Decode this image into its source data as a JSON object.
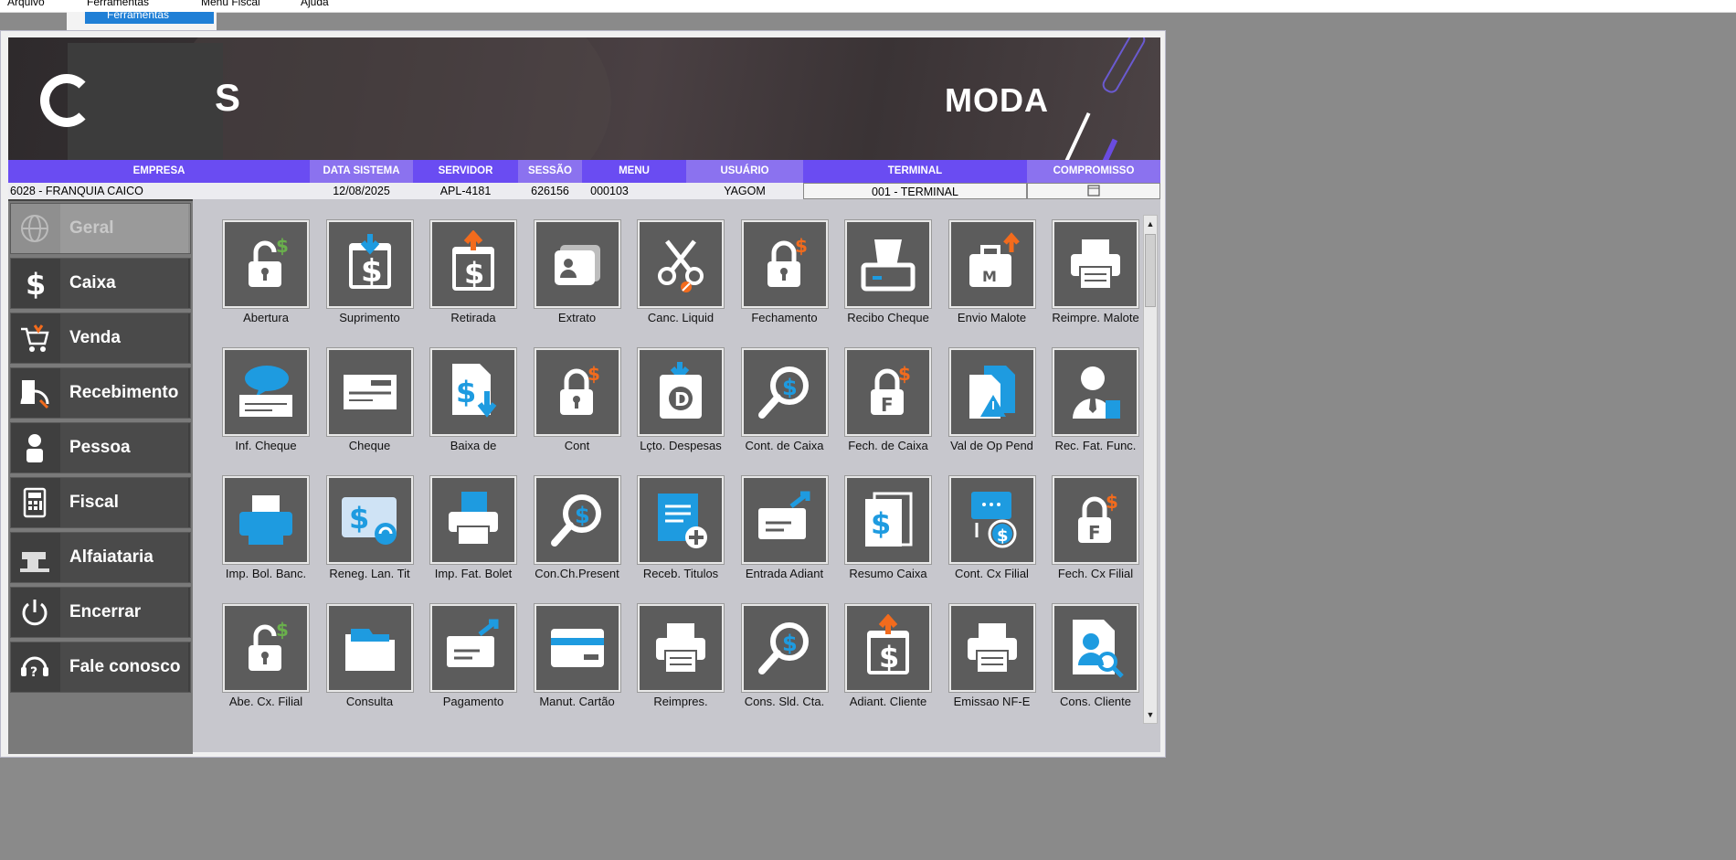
{
  "menubar": {
    "items": [
      "Arquivo",
      "Ferramentas",
      "Menu Fiscal",
      "Ajuda"
    ],
    "dropdown_highlight": "Ferramentas"
  },
  "banner": {
    "brand_suffix": "S",
    "tagline": "MODA"
  },
  "header": {
    "columns": [
      "EMPRESA",
      "DATA SISTEMA",
      "SERVIDOR",
      "SESSÃO",
      "MENU",
      "USUÁRIO",
      "TERMINAL",
      "COMPROMISSO"
    ],
    "values": [
      "6028 - FRANQUIA CAICO",
      "12/08/2025",
      "APL-4181",
      "626156",
      "000103",
      "YAGOM",
      "001 - TERMINAL",
      ""
    ]
  },
  "sidebar": {
    "items": [
      {
        "label": "Geral",
        "icon": "globe-icon",
        "disabled": true
      },
      {
        "label": "Caixa",
        "icon": "dollar-icon"
      },
      {
        "label": "Venda",
        "icon": "cart-icon"
      },
      {
        "label": "Recebimento",
        "icon": "receipt-icon"
      },
      {
        "label": "Pessoa",
        "icon": "person-icon"
      },
      {
        "label": "Fiscal",
        "icon": "calculator-icon"
      },
      {
        "label": "Alfaiataria",
        "icon": "sewing-machine-icon"
      },
      {
        "label": "Encerrar",
        "icon": "power-icon"
      },
      {
        "label": "Fale conosco",
        "icon": "headset-icon"
      }
    ]
  },
  "tiles": [
    {
      "label": "Abertura",
      "icon": "lock-open-dollar-icon"
    },
    {
      "label": "Suprimento",
      "icon": "cash-in-icon"
    },
    {
      "label": "Retirada",
      "icon": "cash-out-icon"
    },
    {
      "label": "Extrato",
      "icon": "id-card-icon"
    },
    {
      "label": "Canc. Liquid",
      "icon": "scissors-icon"
    },
    {
      "label": "Fechamento",
      "icon": "lock-dollar-icon"
    },
    {
      "label": "Recibo Cheque",
      "icon": "receipt-printer-icon"
    },
    {
      "label": "Envio Malote",
      "icon": "briefcase-upload-icon"
    },
    {
      "label": "Reimpre. Malote",
      "icon": "printer-icon"
    },
    {
      "label": "Inf. Cheque",
      "icon": "cheque-chat-icon"
    },
    {
      "label": "Cheque",
      "icon": "cheque-icon"
    },
    {
      "label": "Baixa de",
      "icon": "document-dollar-down-icon"
    },
    {
      "label": "Cont",
      "icon": "lock-dollar-icon"
    },
    {
      "label": "Lçto. Despesas",
      "icon": "expense-icon"
    },
    {
      "label": "Cont. de Caixa",
      "icon": "magnifier-dollar-icon"
    },
    {
      "label": "Fech. de Caixa",
      "icon": "lock-f-dollar-icon"
    },
    {
      "label": "Val de Op Pend",
      "icon": "documents-warning-icon"
    },
    {
      "label": "Rec. Fat. Func.",
      "icon": "employee-document-icon"
    },
    {
      "label": "Imp. Bol. Banc.",
      "icon": "printer-blue-icon"
    },
    {
      "label": "Reneg. Lan. Tit",
      "icon": "dollar-refresh-icon"
    },
    {
      "label": "Imp. Fat. Bolet",
      "icon": "printer-document-icon"
    },
    {
      "label": "Con.Ch.Present",
      "icon": "magnifier-dollar-icon"
    },
    {
      "label": "Receb. Titulos",
      "icon": "scroll-add-icon"
    },
    {
      "label": "Entrada Adiant",
      "icon": "card-send-icon"
    },
    {
      "label": "Resumo Caixa",
      "icon": "dollar-stack-icon"
    },
    {
      "label": "Cont. Cx Filial",
      "icon": "network-dollar-icon"
    },
    {
      "label": "Fech. Cx Filial",
      "icon": "lock-f-dollar-icon"
    },
    {
      "label": "Abe. Cx. Filial",
      "icon": "lock-open-dollar-icon"
    },
    {
      "label": "Consulta",
      "icon": "folder-icon"
    },
    {
      "label": "Pagamento",
      "icon": "card-send-icon"
    },
    {
      "label": "Manut. Cartão",
      "icon": "credit-card-icon"
    },
    {
      "label": "Reimpres.",
      "icon": "printer-icon"
    },
    {
      "label": "Cons. Sld. Cta.",
      "icon": "magnifier-dollar-icon"
    },
    {
      "label": "Adiant. Cliente",
      "icon": "cash-out-icon"
    },
    {
      "label": "Emissao NF-E",
      "icon": "printer-icon"
    },
    {
      "label": "Cons. Cliente",
      "icon": "person-search-icon"
    }
  ],
  "colors": {
    "header_bar": "#6a4cf2",
    "header_alt": "#8b72ef",
    "tile_bg": "#5c5c5c",
    "accent_orange": "#f26b1d",
    "accent_blue": "#1e9be0",
    "accent_green": "#6ab04c"
  }
}
